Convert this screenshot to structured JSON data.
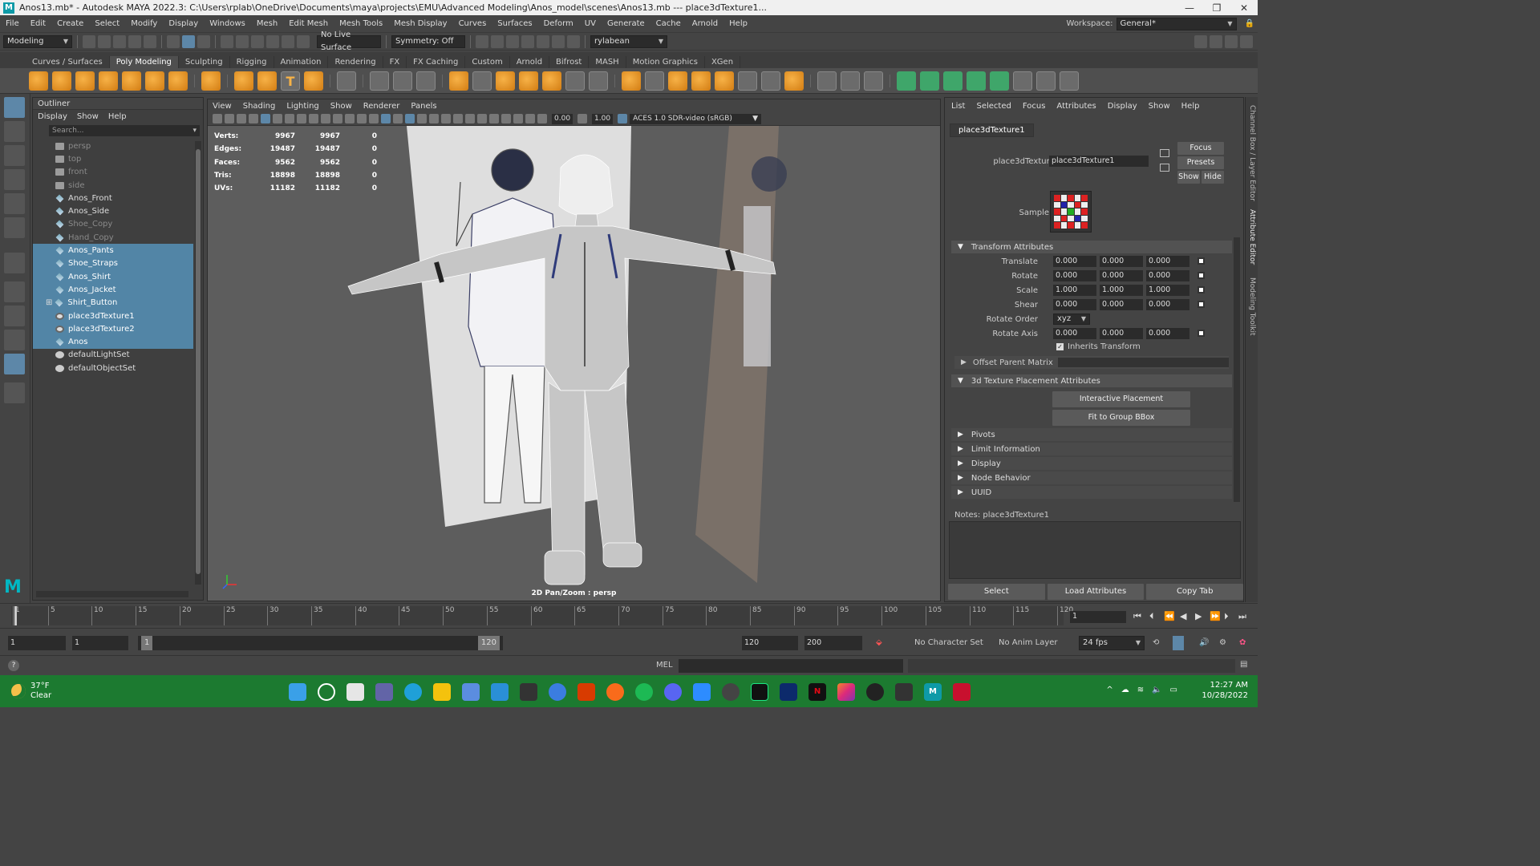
{
  "titlebar": {
    "logo": "M",
    "title": "Anos13.mb* - Autodesk MAYA 2022.3: C:\\Users\\rplab\\OneDrive\\Documents\\maya\\projects\\EMU\\Advanced Modeling\\Anos_model\\scenes\\Anos13.mb   ---   place3dTexture1...",
    "minimize": "—",
    "maximize": "❐",
    "close": "✕"
  },
  "menubar": {
    "items": [
      "File",
      "Edit",
      "Create",
      "Select",
      "Modify",
      "Display",
      "Windows",
      "Mesh",
      "Edit Mesh",
      "Mesh Tools",
      "Mesh Display",
      "Curves",
      "Surfaces",
      "Deform",
      "UV",
      "Generate",
      "Cache",
      "Arnold",
      "Help"
    ],
    "workspace_label": "Workspace:",
    "workspace_value": "General*"
  },
  "statusline": {
    "mode": "Modeling",
    "live_surface": "No Live Surface",
    "symmetry": "Symmetry: Off",
    "user": "rylabean"
  },
  "shelf": {
    "tabs": [
      "Curves / Surfaces",
      "Poly Modeling",
      "Sculpting",
      "Rigging",
      "Animation",
      "Rendering",
      "FX",
      "FX Caching",
      "Custom",
      "Arnold",
      "Bifrost",
      "MASH",
      "Motion Graphics",
      "XGen"
    ],
    "active_tab": "Poly Modeling"
  },
  "outliner": {
    "title": "Outliner",
    "menu": [
      "Display",
      "Show",
      "Help"
    ],
    "search_placeholder": "Search...",
    "items": [
      {
        "name": "persp",
        "icon": "camera-icon",
        "state": "dim"
      },
      {
        "name": "top",
        "icon": "camera-icon",
        "state": "dim"
      },
      {
        "name": "front",
        "icon": "camera-icon",
        "state": "dim"
      },
      {
        "name": "side",
        "icon": "camera-icon",
        "state": "dim"
      },
      {
        "name": "Anos_Front",
        "icon": "mesh-icon",
        "state": "normal"
      },
      {
        "name": "Anos_Side",
        "icon": "mesh-icon",
        "state": "normal"
      },
      {
        "name": "Shoe_Copy",
        "icon": "mesh-icon",
        "state": "dim"
      },
      {
        "name": "Hand_Copy",
        "icon": "mesh-icon",
        "state": "dim"
      },
      {
        "name": "Anos_Pants",
        "icon": "mesh-icon",
        "state": "selected"
      },
      {
        "name": "Shoe_Straps",
        "icon": "mesh-icon",
        "state": "selected"
      },
      {
        "name": "Anos_Shirt",
        "icon": "mesh-icon",
        "state": "selected"
      },
      {
        "name": "Anos_Jacket",
        "icon": "mesh-icon",
        "state": "selected"
      },
      {
        "name": "Shirt_Button",
        "icon": "mesh-icon",
        "state": "selected"
      },
      {
        "name": "place3dTexture1",
        "icon": "texture-icon",
        "state": "selected"
      },
      {
        "name": "place3dTexture2",
        "icon": "texture-icon",
        "state": "selected"
      },
      {
        "name": "Anos",
        "icon": "mesh-icon",
        "state": "selected"
      },
      {
        "name": "defaultLightSet",
        "icon": "set-icon",
        "state": "normal"
      },
      {
        "name": "defaultObjectSet",
        "icon": "set-icon",
        "state": "normal"
      }
    ]
  },
  "viewport": {
    "menu": [
      "View",
      "Shading",
      "Lighting",
      "Show",
      "Renderer",
      "Panels"
    ],
    "near_value": "0.00",
    "far_value": "1.00",
    "color_space": "ACES 1.0 SDR-video (sRGB)",
    "hud": [
      {
        "label": "Verts:",
        "a": "9967",
        "b": "9967",
        "c": "0"
      },
      {
        "label": "Edges:",
        "a": "19487",
        "b": "19487",
        "c": "0"
      },
      {
        "label": "Faces:",
        "a": "9562",
        "b": "9562",
        "c": "0"
      },
      {
        "label": "Tris:",
        "a": "18898",
        "b": "18898",
        "c": "0"
      },
      {
        "label": "UVs:",
        "a": "11182",
        "b": "11182",
        "c": "0"
      }
    ],
    "caption": "2D Pan/Zoom : persp"
  },
  "attribute_editor": {
    "menu": [
      "List",
      "Selected",
      "Focus",
      "Attributes",
      "Display",
      "Show",
      "Help"
    ],
    "tab": "place3dTexture1",
    "node_label": "place3dTexture:",
    "node_value": "place3dTexture1",
    "focus": "Focus",
    "presets": "Presets",
    "show": "Show",
    "hide": "Hide",
    "sample_label": "Sample",
    "transform_section": "Transform Attributes",
    "translate_label": "Translate",
    "translate": [
      "0.000",
      "0.000",
      "0.000"
    ],
    "rotate_label": "Rotate",
    "rotate": [
      "0.000",
      "0.000",
      "0.000"
    ],
    "scale_label": "Scale",
    "scale": [
      "1.000",
      "1.000",
      "1.000"
    ],
    "shear_label": "Shear",
    "shear": [
      "0.000",
      "0.000",
      "0.000"
    ],
    "rotate_order_label": "Rotate Order",
    "rotate_order": "xyz",
    "rotate_axis_label": "Rotate Axis",
    "rotate_axis": [
      "0.000",
      "0.000",
      "0.000"
    ],
    "inherits_transform": "Inherits Transform",
    "offset_parent_matrix": "Offset Parent Matrix",
    "placement_section": "3d Texture Placement Attributes",
    "interactive_placement": "Interactive Placement",
    "fit_to_group": "Fit to Group BBox",
    "collapsed_sections": [
      "Pivots",
      "Limit Information",
      "Display",
      "Node Behavior",
      "UUID"
    ],
    "notes": "Notes:  place3dTexture1",
    "bottom_buttons": [
      "Select",
      "Load Attributes",
      "Copy Tab"
    ]
  },
  "side_tabs": [
    "Channel Box / Layer Editor",
    "Attribute Editor",
    "Modeling Toolkit"
  ],
  "timeline": {
    "ticks": [
      "1",
      "5",
      "10",
      "15",
      "20",
      "25",
      "30",
      "35",
      "40",
      "45",
      "50",
      "55",
      "60",
      "65",
      "70",
      "75",
      "80",
      "85",
      "90",
      "95",
      "100",
      "105",
      "110",
      "115",
      "120"
    ],
    "current_frame": "1"
  },
  "range": {
    "start": "1",
    "playback_start": "1",
    "slider_start": "1",
    "slider_end": "120",
    "playback_end": "120",
    "end": "200",
    "character_set": "No Character Set",
    "anim_layer": "No Anim Layer",
    "fps": "24 fps"
  },
  "command_line": {
    "language": "MEL",
    "help": "?"
  },
  "taskbar": {
    "temperature": "37°F",
    "condition": "Clear",
    "time": "12:27 AM",
    "date": "10/28/2022"
  }
}
